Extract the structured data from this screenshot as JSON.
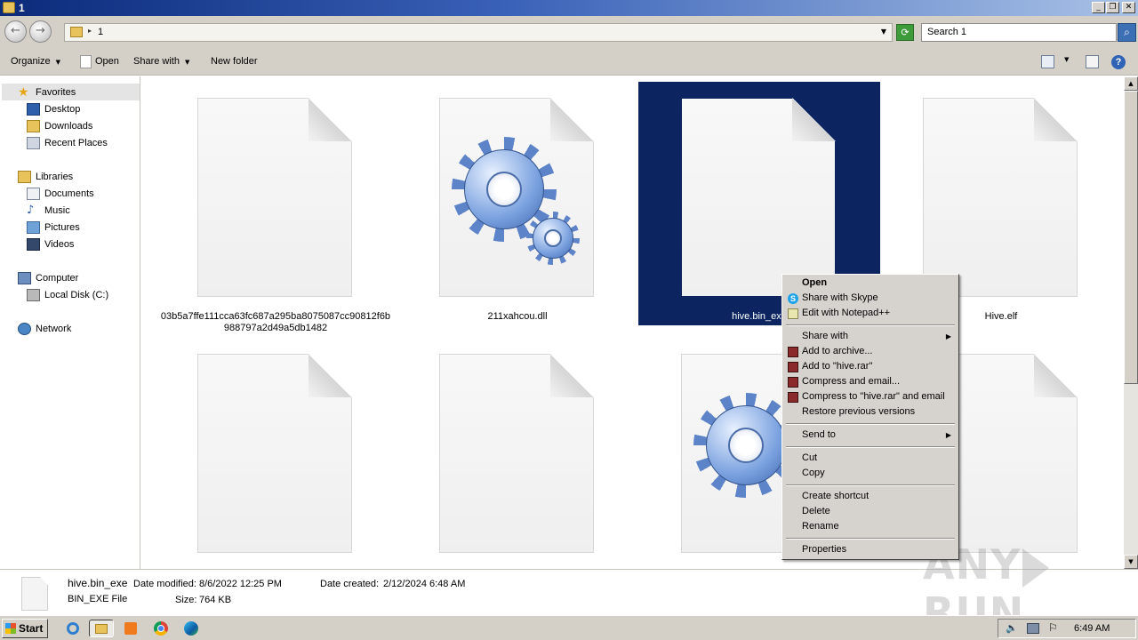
{
  "window": {
    "title": "1"
  },
  "address": {
    "path": "1",
    "search_placeholder": "Search 1"
  },
  "toolbar": {
    "organize": "Organize",
    "open": "Open",
    "share_with": "Share with",
    "new_folder": "New folder"
  },
  "nav": {
    "favorites": "Favorites",
    "favorites_items": [
      "Desktop",
      "Downloads",
      "Recent Places"
    ],
    "libraries": "Libraries",
    "libraries_items": [
      "Documents",
      "Music",
      "Pictures",
      "Videos"
    ],
    "computer": "Computer",
    "computer_items": [
      "Local Disk (C:)"
    ],
    "network": "Network"
  },
  "files": [
    {
      "name": "03b5a7ffe111cca63fc687a295ba8075087cc90812f6b988797a2d49a5db1482",
      "icon": "blank-file-icon"
    },
    {
      "name": "211xahcou.dll",
      "icon": "gear-icon"
    },
    {
      "name": "hive.bin_exe",
      "icon": "blank-file-icon",
      "selected": true
    },
    {
      "name": "Hive.elf",
      "icon": "blank-file-icon"
    },
    {
      "name": "",
      "icon": "blank-file-icon"
    },
    {
      "name": "",
      "icon": "blank-file-icon"
    },
    {
      "name": "",
      "icon": "gear-icon"
    },
    {
      "name": "",
      "icon": "blank-file-icon"
    }
  ],
  "context_menu": {
    "open": "Open",
    "share_skype": "Share with Skype",
    "edit_notepad": "Edit with Notepad++",
    "share_with": "Share with",
    "add_archive": "Add to archive...",
    "add_rar": "Add to \"hive.rar\"",
    "compress_email": "Compress and email...",
    "compress_rar_email": "Compress to \"hive.rar\" and email",
    "restore": "Restore previous versions",
    "send_to": "Send to",
    "cut": "Cut",
    "copy": "Copy",
    "create_shortcut": "Create shortcut",
    "delete": "Delete",
    "rename": "Rename",
    "properties": "Properties"
  },
  "details": {
    "name": "hive.bin_exe",
    "type": "BIN_EXE File",
    "modified_label": "Date modified:",
    "modified_value": "8/6/2022 12:25 PM",
    "created_label": "Date created:",
    "created_value": "2/12/2024 6:48 AM",
    "size_label": "Size:",
    "size_value": "764 KB"
  },
  "taskbar": {
    "start": "Start",
    "clock": "6:49 AM"
  },
  "watermark": {
    "left": "ANY",
    "right": "RUN"
  },
  "colors": {
    "selection": "#0c2560",
    "accent": "#3d6fb4",
    "menu_bg": "#d6d3ce"
  }
}
